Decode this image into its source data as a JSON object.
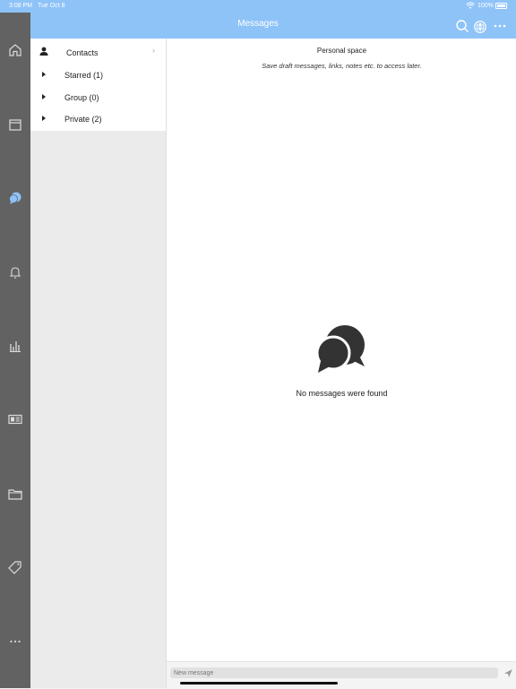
{
  "status": {
    "time": "3:08 PM",
    "date": "Tue Oct 8",
    "battery": "100%"
  },
  "header": {
    "title": "Messages",
    "icons": [
      "search-icon",
      "globe-icon",
      "more-icon"
    ]
  },
  "rail": {
    "items": [
      "home-icon",
      "calendar-icon",
      "messages-icon",
      "bell-icon",
      "chart-icon",
      "news-icon",
      "folder-icon",
      "tag-icon",
      "more-icon"
    ],
    "active": "messages-icon",
    "active_color": "#8ec3f8"
  },
  "contacts": {
    "title": "Contacts",
    "groups": [
      {
        "label": "Starred (1)"
      },
      {
        "label": "Group (0)"
      },
      {
        "label": "Private (2)"
      }
    ]
  },
  "main": {
    "space_title": "Personal space",
    "hint": "Save draft messages, links, notes etc. to access later.",
    "empty_text": "No messages were found"
  },
  "composer": {
    "placeholder": "New message"
  },
  "colors": {
    "accent": "#8ec3f8",
    "rail": "#626262"
  }
}
